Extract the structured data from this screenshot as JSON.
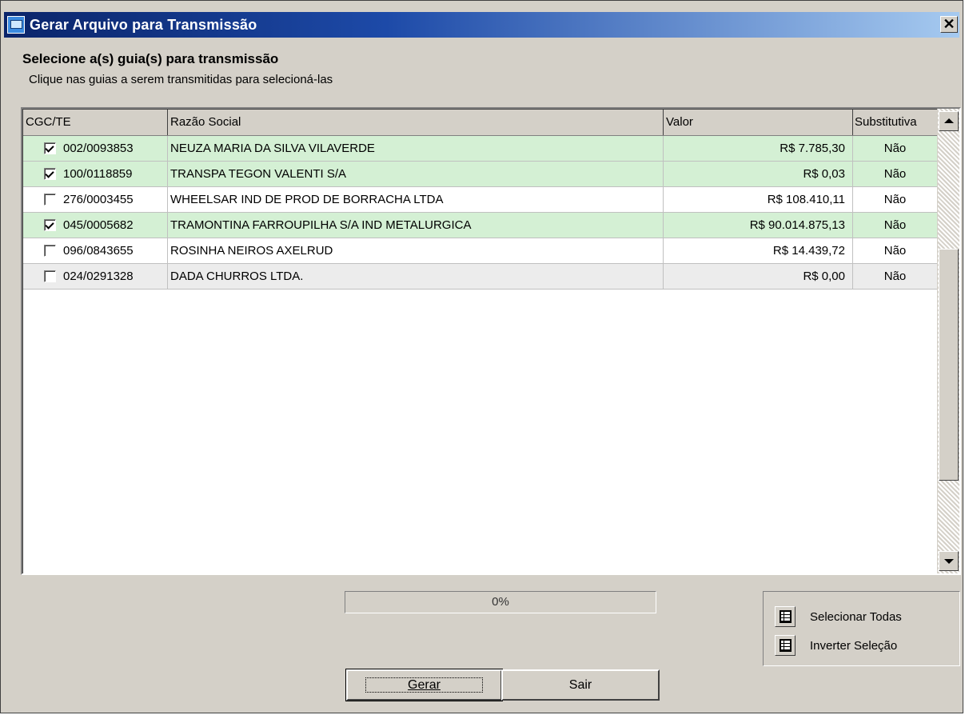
{
  "window": {
    "title": "Gerar Arquivo para Transmissão",
    "close_glyph": "✕"
  },
  "heading": "Selecione a(s) guia(s) para transmissão",
  "subheading": "Clique nas guias a serem transmitidas para selecioná-las",
  "grid": {
    "columns": [
      "CGC/TE",
      "Razão Social",
      "Valor",
      "Substitutiva"
    ],
    "rows": [
      {
        "checked": true,
        "cgc": "002/0093853",
        "razao": "NEUZA MARIA DA SILVA VILAVERDE",
        "valor": "R$ 7.785,30",
        "sub": "Não"
      },
      {
        "checked": true,
        "cgc": "100/0118859",
        "razao": "TRANSPA TEGON VALENTI S/A",
        "valor": "R$ 0,03",
        "sub": "Não"
      },
      {
        "checked": false,
        "cgc": "276/0003455",
        "razao": "WHEELSAR IND DE PROD DE BORRACHA LTDA",
        "valor": "R$ 108.410,11",
        "sub": "Não"
      },
      {
        "checked": true,
        "cgc": "045/0005682",
        "razao": "TRAMONTINA FARROUPILHA S/A IND METALURGICA",
        "valor": "R$ 90.014.875,13",
        "sub": "Não"
      },
      {
        "checked": false,
        "cgc": "096/0843655",
        "razao": "ROSINHA NEIROS AXELRUD",
        "valor": "R$ 14.439,72",
        "sub": "Não"
      },
      {
        "checked": false,
        "cgc": "024/0291328",
        "razao": "DADA CHURROS LTDA.",
        "valor": "R$ 0,00",
        "sub": "Não"
      }
    ]
  },
  "progress": {
    "label": "0%",
    "value": 0
  },
  "buttons": {
    "gerar": "Gerar",
    "sair": "Sair",
    "selecionar_todas": "Selecionar Todas",
    "inverter_selecao": "Inverter Seleção"
  },
  "colors": {
    "selected_row": "#d4f0d4",
    "title_start": "#0a246a",
    "title_end": "#a6caf0"
  }
}
